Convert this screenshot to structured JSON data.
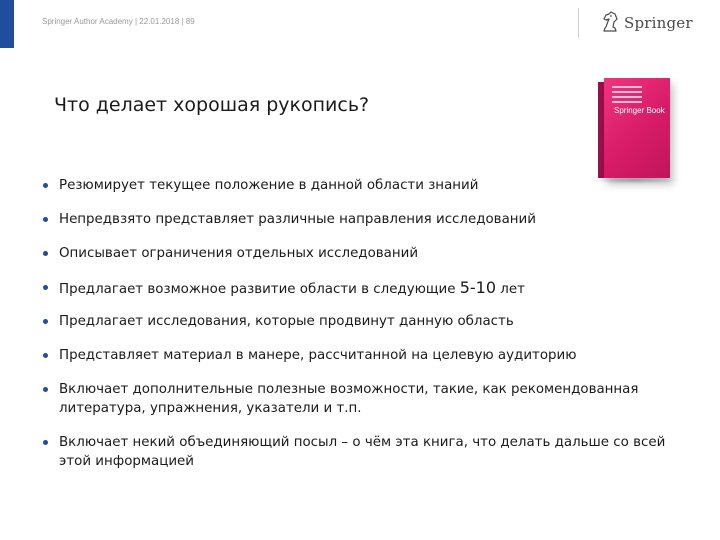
{
  "header": {
    "meta": "Springer Author Academy | 22.01.2018 | 89",
    "logo_text": "Springer"
  },
  "title": "Что делает хорошая рукопись?",
  "book": {
    "cover_title": "Springer Book"
  },
  "bullets": [
    "Резюмирует текущее положение в данной области знаний",
    "Непредвзято представляет различные направления исследований",
    "Описывает ограничения отдельных исследований",
    {
      "before": "Предлагает возможное развитие области в следующие",
      "number": "5-10",
      "after": "лет"
    },
    "Предлагает исследования, которые продвинут данную область",
    "Представляет материал в манере, рассчитанной на целевую аудиторию",
    "Включает дополнительные полезные возможности, такие, как рекомендованная литература, упражнения, указатели и т.п.",
    "Включает некий объединяющий посыл – о чём эта книга, что делать дальше со всей этой информацией"
  ],
  "colors": {
    "brand_blue": "#1f4e9c",
    "book_pink": "#d81b67"
  }
}
